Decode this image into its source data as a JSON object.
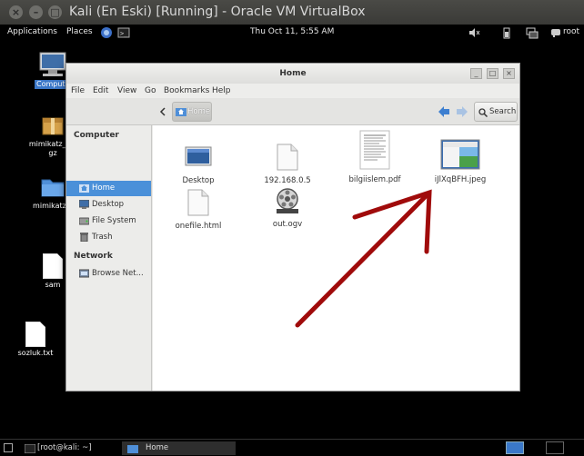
{
  "host_window": {
    "title": "Kali (En Eski) [Running] - Oracle VM VirtualBox",
    "buttons": {
      "close": "×",
      "minimize": "–",
      "maximize": "□"
    }
  },
  "top_panel": {
    "applications": "Applications",
    "places": "Places",
    "clock": "Thu Oct 11,  5:55 AM",
    "user": "root",
    "icons": [
      "iceweasel-icon",
      "terminal-icon",
      "volume-muted-icon",
      "battery-icon",
      "network-icon",
      "user-icon"
    ]
  },
  "desktop_icons": [
    {
      "label": "Computer",
      "icon": "computer-icon",
      "selected": true
    },
    {
      "label": "mimikatz_trunk.tar.gz",
      "line1": "mimikatz_tru",
      "line2": "gz",
      "icon": "archive-icon"
    },
    {
      "label": "mimikatz_t",
      "icon": "folder-icon"
    },
    {
      "label": "sam",
      "icon": "file-icon"
    },
    {
      "label": "sozluk.txt",
      "icon": "text-file-icon"
    }
  ],
  "file_manager": {
    "title": "Home",
    "controls": {
      "minimize": "_",
      "maximize": "□",
      "close": "×"
    },
    "menu": [
      "File",
      "Edit",
      "View",
      "Go",
      "Bookmarks",
      "Help"
    ],
    "location": "Home",
    "search_label": "Search",
    "sidebar": {
      "computer_heading": "Computer",
      "items": [
        {
          "label": "Home",
          "icon": "home-icon",
          "active": true
        },
        {
          "label": "Desktop",
          "icon": "desktop-icon"
        },
        {
          "label": "File System",
          "icon": "drive-icon"
        },
        {
          "label": "Trash",
          "icon": "trash-icon"
        }
      ],
      "network_heading": "Network",
      "network_items": [
        {
          "label": "Browse Net...",
          "icon": "network-icon"
        }
      ]
    },
    "files": [
      {
        "name": "Desktop",
        "icon": "desktop-folder-icon"
      },
      {
        "name": "192.168.0.5",
        "icon": "file-icon"
      },
      {
        "name": "bilgiislem.pdf",
        "icon": "pdf-icon"
      },
      {
        "name": "iJlXqBFH.jpeg",
        "icon": "image-icon"
      },
      {
        "name": "onefile.html",
        "icon": "html-icon"
      },
      {
        "name": "out.ogv",
        "icon": "video-icon"
      }
    ]
  },
  "bottom_panel": {
    "tasks": [
      {
        "label": "[root@kali: ~]",
        "icon": "terminal-icon"
      },
      {
        "label": "Home",
        "icon": "folder-icon"
      }
    ]
  },
  "annotation": {
    "color": "#a00b0b",
    "description_icon": "red-arrow"
  }
}
